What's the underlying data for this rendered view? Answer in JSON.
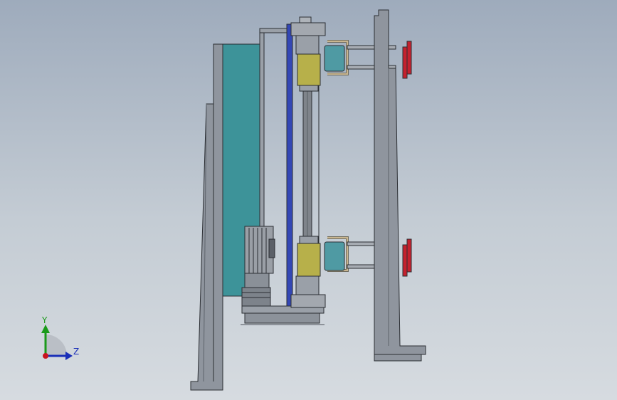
{
  "viewport": {
    "background_top": "#9eabbc",
    "background_bottom": "#d6dbe0"
  },
  "triad": {
    "y_label": "Y",
    "z_label": "Z",
    "y_color": "#1a9a1a",
    "z_color": "#1a2fb8",
    "x_color": "#c8141e"
  },
  "colors": {
    "frame": "#8f959e",
    "frame_dark": "#6d737c",
    "teal_panel": "#3d9399",
    "blue_strip": "#3347b5",
    "rod": "#7f848b",
    "bearing": "#b7b04a",
    "clamp": "#4f9aa3",
    "bracket": "#c9b690",
    "red_stop": "#c4212e"
  }
}
